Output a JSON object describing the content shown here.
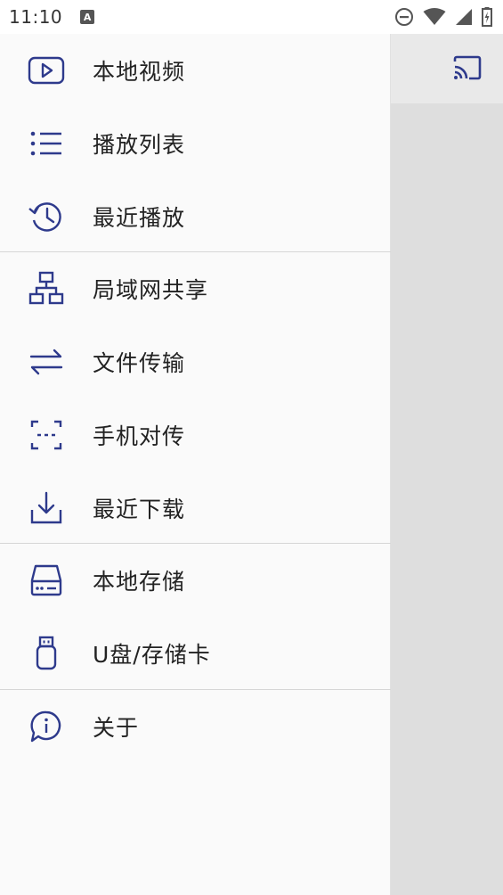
{
  "status": {
    "time": "11:10",
    "notification_badge": "A"
  },
  "toolbar": {
    "cast_icon": "cast-icon"
  },
  "colors": {
    "icon_accent": "#2e3a8c",
    "drawer_bg": "#fafafa",
    "text": "#222222"
  },
  "drawer": {
    "groups": [
      {
        "items": [
          {
            "label": "本地视频",
            "icon": "play-video-icon"
          },
          {
            "label": "播放列表",
            "icon": "list-icon"
          },
          {
            "label": "最近播放",
            "icon": "history-icon"
          }
        ]
      },
      {
        "items": [
          {
            "label": "局域网共享",
            "icon": "network-icon"
          },
          {
            "label": "文件传输",
            "icon": "transfer-arrows-icon"
          },
          {
            "label": "手机对传",
            "icon": "scan-frame-icon"
          },
          {
            "label": "最近下载",
            "icon": "download-icon"
          }
        ]
      },
      {
        "items": [
          {
            "label": "本地存储",
            "icon": "hard-drive-icon"
          },
          {
            "label": "U盘/存储卡",
            "icon": "usb-drive-icon"
          }
        ]
      },
      {
        "items": [
          {
            "label": "关于",
            "icon": "info-bubble-icon"
          }
        ]
      }
    ]
  }
}
